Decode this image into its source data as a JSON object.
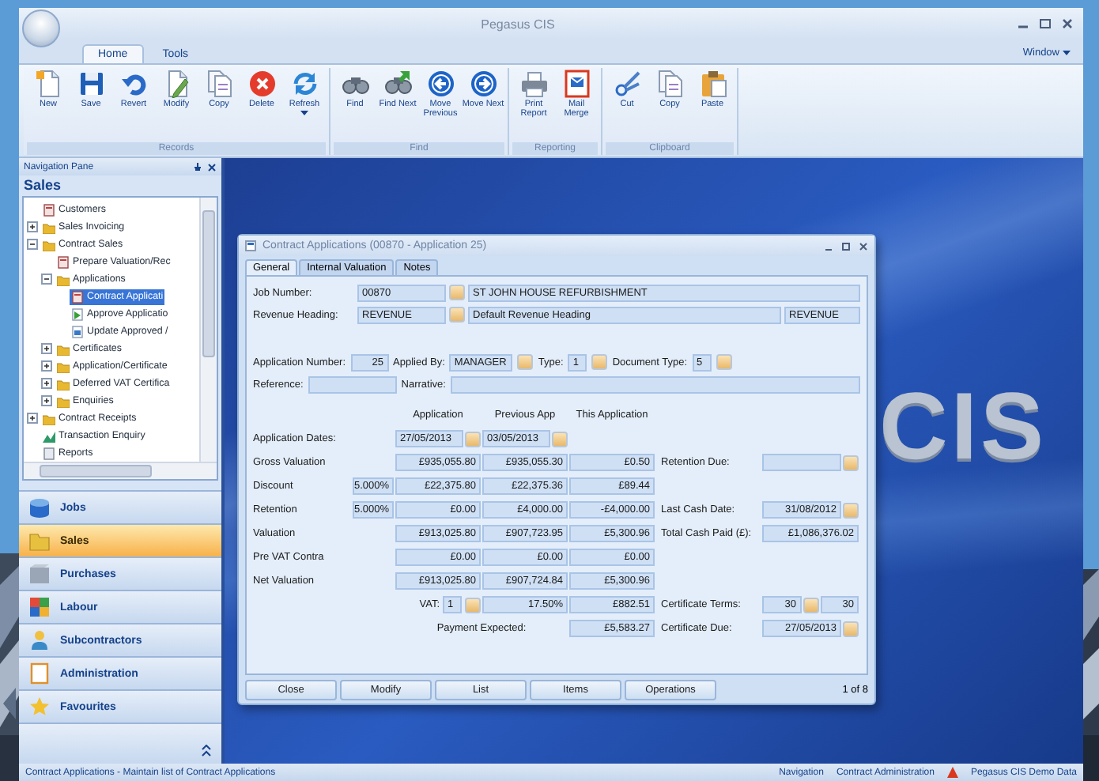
{
  "app": {
    "title": "Pegasus CIS",
    "window_menu": "Window"
  },
  "ribbon_tabs": [
    {
      "label": "Home",
      "selected": true
    },
    {
      "label": "Tools",
      "selected": false
    }
  ],
  "ribbon_groups": [
    {
      "label": "Records",
      "buttons": [
        {
          "label": "New",
          "dropdown": false
        },
        {
          "label": "Save",
          "dropdown": false
        },
        {
          "label": "Revert",
          "dropdown": false
        },
        {
          "label": "Modify",
          "dropdown": false
        },
        {
          "label": "Copy",
          "dropdown": false
        },
        {
          "label": "Delete",
          "dropdown": false
        },
        {
          "label": "Refresh",
          "dropdown": true
        }
      ]
    },
    {
      "label": "Find",
      "buttons": [
        {
          "label": "Find",
          "dropdown": false
        },
        {
          "label": "Find Next",
          "dropdown": false
        },
        {
          "label": "Move Previous",
          "dropdown": false
        },
        {
          "label": "Move Next",
          "dropdown": false
        }
      ]
    },
    {
      "label": "Reporting",
      "buttons": [
        {
          "label": "Print Report",
          "dropdown": false
        },
        {
          "label": "Mail Merge",
          "dropdown": false
        }
      ]
    },
    {
      "label": "Clipboard",
      "buttons": [
        {
          "label": "Cut",
          "dropdown": false
        },
        {
          "label": "Copy",
          "dropdown": false
        },
        {
          "label": "Paste",
          "dropdown": false
        }
      ]
    }
  ],
  "nav": {
    "title": "Navigation Pane",
    "section": "Sales",
    "tree": [
      {
        "label": "Customers",
        "kind": "form",
        "selected": false
      },
      {
        "label": "Sales Invoicing",
        "kind": "folder",
        "expanded": false,
        "selected": false
      },
      {
        "label": "Contract Sales",
        "kind": "folder",
        "expanded": true,
        "selected": false,
        "children": [
          {
            "label": "Prepare Valuation/Rec",
            "kind": "form",
            "selected": false
          },
          {
            "label": "Applications",
            "kind": "folder",
            "expanded": true,
            "selected": false,
            "children": [
              {
                "label": "Contract Applicati",
                "kind": "form",
                "selected": true
              },
              {
                "label": "Approve Applicatio",
                "kind": "approve",
                "selected": false
              },
              {
                "label": "Update Approved /",
                "kind": "update",
                "selected": false
              }
            ]
          },
          {
            "label": "Certificates",
            "kind": "folder",
            "expanded": false,
            "selected": false
          },
          {
            "label": "Application/Certificate",
            "kind": "folder",
            "expanded": false,
            "selected": false
          },
          {
            "label": "Deferred VAT Certifica",
            "kind": "folder",
            "expanded": false,
            "selected": false
          },
          {
            "label": "Enquiries",
            "kind": "folder",
            "expanded": false,
            "selected": false
          }
        ]
      },
      {
        "label": "Contract Receipts",
        "kind": "folder",
        "expanded": false,
        "selected": false
      },
      {
        "label": "Transaction Enquiry",
        "kind": "chart",
        "selected": false
      },
      {
        "label": "Reports",
        "kind": "report",
        "selected": false
      }
    ],
    "buttons": [
      {
        "label": "Jobs",
        "selected": false
      },
      {
        "label": "Sales",
        "selected": true
      },
      {
        "label": "Purchases",
        "selected": false
      },
      {
        "label": "Labour",
        "selected": false
      },
      {
        "label": "Subcontractors",
        "selected": false
      },
      {
        "label": "Administration",
        "selected": false
      },
      {
        "label": "Favourites",
        "selected": false
      }
    ]
  },
  "workspace": {
    "logo": "CIS"
  },
  "child": {
    "title": "Contract Applications (00870 - Application 25)",
    "tabs": [
      {
        "label": "General",
        "selected": true
      },
      {
        "label": "Internal Valuation",
        "selected": false
      },
      {
        "label": "Notes",
        "selected": false
      }
    ],
    "job": {
      "label": "Job Number:",
      "code": "00870",
      "description": "ST JOHN HOUSE REFURBISHMENT"
    },
    "revenue": {
      "label": "Revenue Heading:",
      "code": "REVENUE",
      "description": "Default Revenue Heading",
      "extra": "REVENUE"
    },
    "fields": [
      {
        "label": "Application Number:",
        "value": "25",
        "lookup": false
      },
      {
        "label": "Applied By:",
        "value": "MANAGER",
        "lookup": true
      },
      {
        "label": "Type:",
        "value": "1",
        "lookup": true
      },
      {
        "label": "Document Type:",
        "value": "5",
        "lookup": true
      }
    ],
    "text_fields": [
      {
        "label": "Reference:"
      },
      {
        "label": "Narrative:"
      }
    ],
    "columns": [
      "Application",
      "Previous App",
      "This Application"
    ],
    "rows": [
      {
        "kind": "dates",
        "label": "Application Dates:",
        "values": [
          "27/05/2013",
          "03/05/2013"
        ]
      },
      {
        "kind": "amounts",
        "label": "Gross Valuation",
        "values": [
          "£935,055.80",
          "£935,055.30",
          "£0.50"
        ],
        "side": {
          "label": "Retention Due:",
          "lookup": true
        }
      },
      {
        "kind": "amounts",
        "label": "Discount",
        "percent": "5.000%",
        "values": [
          "£22,375.80",
          "£22,375.36",
          "£89.44"
        ]
      },
      {
        "kind": "amounts",
        "label": "Retention",
        "percent": "5.000%",
        "values": [
          "£0.00",
          "£4,000.00",
          "-£4,000.00"
        ],
        "side": {
          "label": "Last Cash Date:",
          "values": [
            "31/08/2012"
          ],
          "lookup": true
        }
      },
      {
        "kind": "amounts",
        "label": "Valuation",
        "values": [
          "£913,025.80",
          "£907,723.95",
          "£5,300.96"
        ],
        "side": {
          "label": "Total Cash Paid (£):",
          "values": [
            "£1,086,376.02"
          ],
          "lookup": false
        }
      },
      {
        "kind": "amounts",
        "label": "Pre VAT Contra",
        "values": [
          "£0.00",
          "£0.00",
          "£0.00"
        ]
      },
      {
        "kind": "amounts",
        "label": "Net Valuation",
        "values": [
          "£913,025.80",
          "£907,724.84",
          "£5,300.96"
        ]
      },
      {
        "kind": "vat",
        "label": "VAT:",
        "code": "1",
        "rate": "17.50%",
        "value": "£882.51",
        "side": {
          "label": "Certificate Terms:",
          "values": [
            "30",
            "30"
          ],
          "lookup": true
        }
      },
      {
        "kind": "payment",
        "label": "Payment Expected:",
        "value": "£5,583.27",
        "side": {
          "label": "Certificate Due:",
          "values": [
            "27/05/2013"
          ],
          "lookup": true
        }
      }
    ],
    "buttons": [
      "Close",
      "Modify",
      "List",
      "Items",
      "Operations"
    ],
    "record": "1 of 8"
  },
  "status_bar": {
    "text": "Contract Applications - Maintain list of Contract Applications",
    "panels": [
      "Navigation",
      "Contract Administration",
      "Pegasus CIS Demo Data"
    ]
  }
}
